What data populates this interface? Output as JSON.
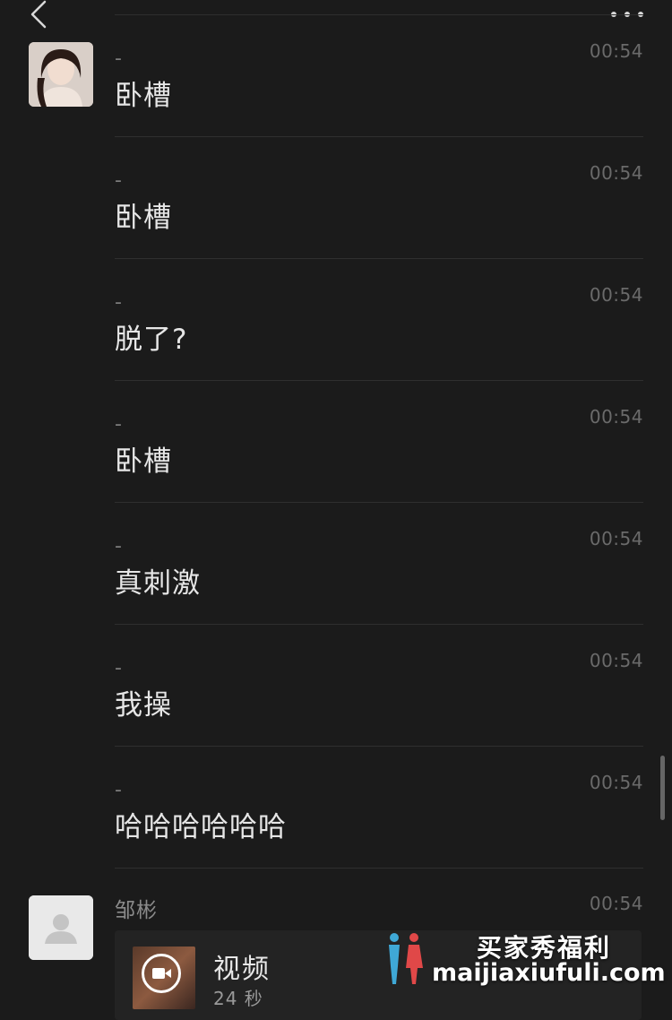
{
  "header": {
    "back_icon": "chevron-left-icon",
    "more_icon": "more-dots-icon"
  },
  "messages": [
    {
      "sender": "-",
      "time": "00:54",
      "text": "卧槽"
    },
    {
      "sender": "-",
      "time": "00:54",
      "text": "卧槽"
    },
    {
      "sender": "-",
      "time": "00:54",
      "text": "脱了?"
    },
    {
      "sender": "-",
      "time": "00:54",
      "text": "卧槽"
    },
    {
      "sender": "-",
      "time": "00:54",
      "text": "真刺激"
    },
    {
      "sender": "-",
      "time": "00:54",
      "text": "我操"
    },
    {
      "sender": "-",
      "time": "00:54",
      "text": "哈哈哈哈哈哈"
    }
  ],
  "last_message": {
    "sender": "邹彬",
    "time": "00:54",
    "video": {
      "title": "视频",
      "duration": "24 秒",
      "icon": "video-camera-icon"
    }
  },
  "watermark": {
    "line1": "买家秀福利",
    "line2": "maijiaxiufuli.com"
  },
  "colors": {
    "background": "#1b1b1b",
    "text": "#e6e6e6",
    "meta": "#6a6a6a",
    "divider": "#2f2f2f"
  }
}
